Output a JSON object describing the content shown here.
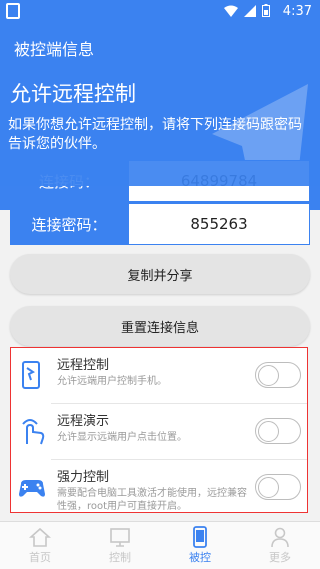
{
  "status_bar": {
    "time": "4:37"
  },
  "header": {
    "title": "被控端信息",
    "big_title": "允许远程控制",
    "description": "如果你想允许远程控制，请将下列连接码跟密码告诉您的伙伴。"
  },
  "connection": {
    "code_label": "连接码：",
    "code_value": "64899784",
    "password_label": "连接密码：",
    "password_value": "855263"
  },
  "buttons": {
    "copy_share": "复制并分享",
    "reset_info": "重置连接信息"
  },
  "settings": [
    {
      "title": "远程控制",
      "subtitle": "允许远端用户控制手机。",
      "enabled": false
    },
    {
      "title": "远程演示",
      "subtitle": "允许显示远端用户点击位置。",
      "enabled": false
    },
    {
      "title": "强力控制",
      "subtitle": "需要配合电脑工具激活才能使用，远控兼容性强，root用户可直接开启。",
      "enabled": false
    }
  ],
  "tabs": [
    {
      "label": "首页",
      "icon": "home-icon"
    },
    {
      "label": "控制",
      "icon": "monitor-icon"
    },
    {
      "label": "被控",
      "icon": "phone-icon"
    },
    {
      "label": "更多",
      "icon": "user-icon"
    }
  ],
  "colors": {
    "primary": "#3b82f0",
    "highlight_border": "#ee3333"
  }
}
